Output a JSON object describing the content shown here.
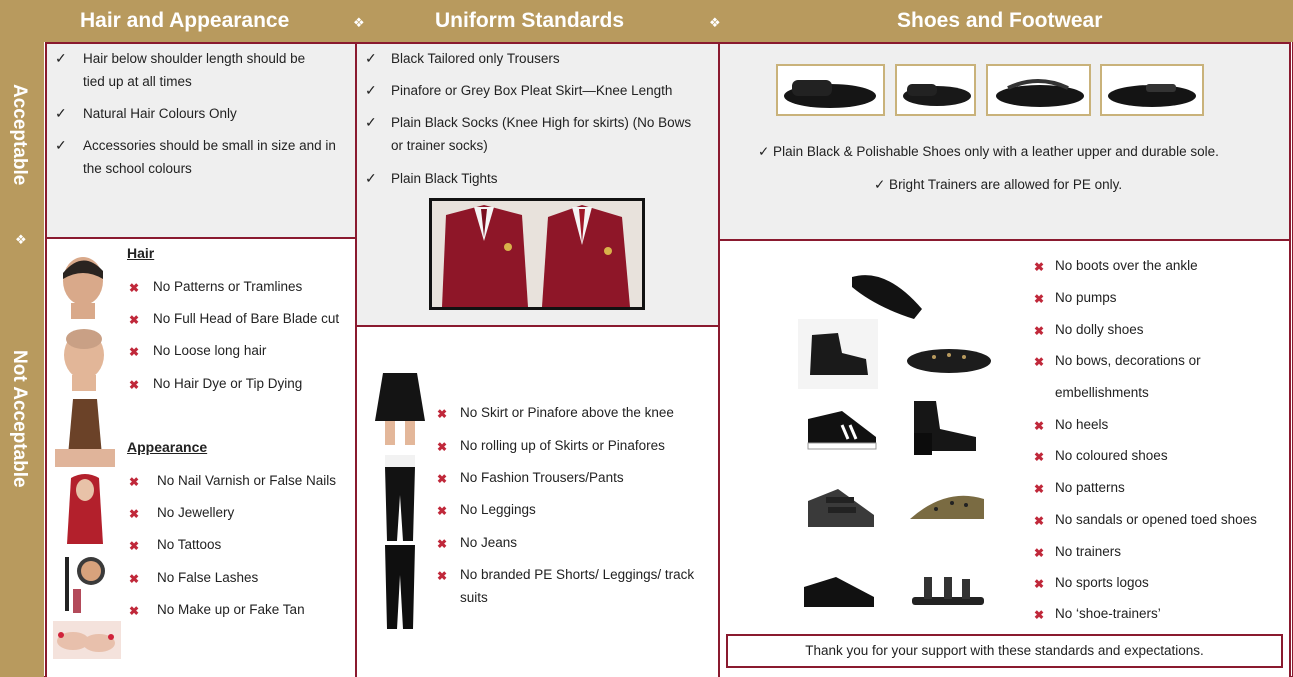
{
  "header": {
    "hair_title": "Hair and Appearance",
    "uniform_title": "Uniform Standards",
    "shoes_title": "Shoes and Footwear",
    "separator": "❖"
  },
  "side": {
    "acceptable": "Acceptable",
    "not_acceptable": "Not Acceptable",
    "separator": "❖"
  },
  "marks": {
    "check": "✓",
    "cross": "✖"
  },
  "hair_ok": [
    "Hair below shoulder length should be",
    "tied up at all times",
    "Natural Hair Colours Only",
    "Accessories should be small in size and in",
    "the school colours"
  ],
  "uniform_ok": [
    "Black Tailored only Trousers",
    "Pinafore or Grey Box Pleat Skirt—Knee Length",
    "Plain Black Socks  (Knee High for skirts) (No Bows",
    "or trainer socks)",
    "Plain Black Tights"
  ],
  "shoes_ok": [
    "✓ Plain Black & Polishable Shoes only with a leather upper and durable sole.",
    "✓ Bright Trainers are allowed for PE only."
  ],
  "hair_no": {
    "heading": "Hair",
    "items": [
      "No Patterns or Tramlines",
      "No Full Head of Bare Blade cut",
      "No Loose long hair",
      "No Hair Dye or Tip Dying"
    ]
  },
  "appearance_no": {
    "heading": "Appearance",
    "items": [
      "No Nail Varnish or False Nails",
      "No Jewellery",
      "No Tattoos",
      "No False Lashes",
      "No Make up or Fake Tan"
    ]
  },
  "uniform_no": [
    "No Skirt or Pinafore above the knee",
    "No rolling up of Skirts or Pinafores",
    "No Fashion Trousers/Pants",
    "No Leggings",
    "No Jeans",
    "No branded PE Shorts/ Leggings/ track",
    "suits"
  ],
  "shoes_no": [
    "No boots over the ankle",
    "No pumps",
    "No dolly shoes",
    "No bows, decorations or",
    "embellishments",
    "No heels",
    "No coloured shoes",
    "No patterns",
    "No sandals or opened toed shoes",
    "No trainers",
    "No sports logos",
    "No ‘shoe-trainers’"
  ],
  "thanks": "Thank you for your support with these standards and expectations."
}
